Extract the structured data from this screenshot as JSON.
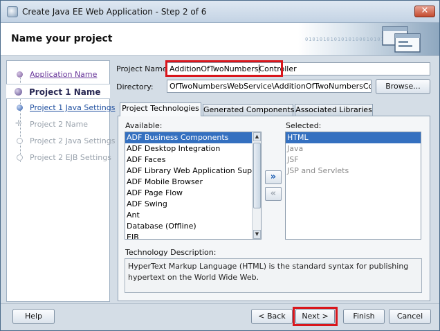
{
  "window": {
    "title": "Create Java EE Web Application - Step 2 of 6",
    "close_label": "✕"
  },
  "header": {
    "title": "Name your project",
    "decoration_digits": "01010101010101000101010101"
  },
  "nav": {
    "items": [
      {
        "label": "Application Name",
        "state": "visited"
      },
      {
        "label": "Project 1 Name",
        "state": "current"
      },
      {
        "label": "Project 1 Java Settings",
        "state": "link"
      },
      {
        "label": "Project 2 Name",
        "state": "disabled"
      },
      {
        "label": "Project 2 Java Settings",
        "state": "disabled"
      },
      {
        "label": "Project 2 EJB Settings",
        "state": "disabled"
      }
    ]
  },
  "form": {
    "project_name_label": "Project Name:",
    "project_name_value_before_caret": "AdditionOfTwoNumbers",
    "project_name_value_after_caret": "Controller",
    "directory_label": "Directory:",
    "directory_value": "OfTwoNumbersWebService\\AdditionOfTwoNumbersController",
    "browse_label": "Browse..."
  },
  "tabs": [
    {
      "label": "Project Technologies",
      "active": true
    },
    {
      "label": "Generated Components",
      "active": false
    },
    {
      "label": "Associated Libraries",
      "active": false
    }
  ],
  "technologies": {
    "available_label": "Available:",
    "available": [
      "ADF Business Components",
      "ADF Desktop Integration",
      "ADF Faces",
      "ADF Library Web Application Support",
      "ADF Mobile Browser",
      "ADF Page Flow",
      "ADF Swing",
      "Ant",
      "Database (Offline)",
      "EJB"
    ],
    "available_selected_index": 0,
    "selected_label": "Selected:",
    "selected": [
      "HTML",
      "Java",
      "JSF",
      "JSP and Servlets"
    ],
    "selected_selected_index": 0,
    "add_label": "»",
    "remove_label": "«",
    "description_label": "Technology Description:",
    "description": "HyperText Markup Language (HTML) is the standard syntax for publishing hypertext on the World Wide Web."
  },
  "footer": {
    "help": "Help",
    "back": "< Back",
    "next": "Next >",
    "finish": "Finish",
    "cancel": "Cancel"
  },
  "colors": {
    "highlight": "#d9161c",
    "selection": "#3470c0"
  }
}
